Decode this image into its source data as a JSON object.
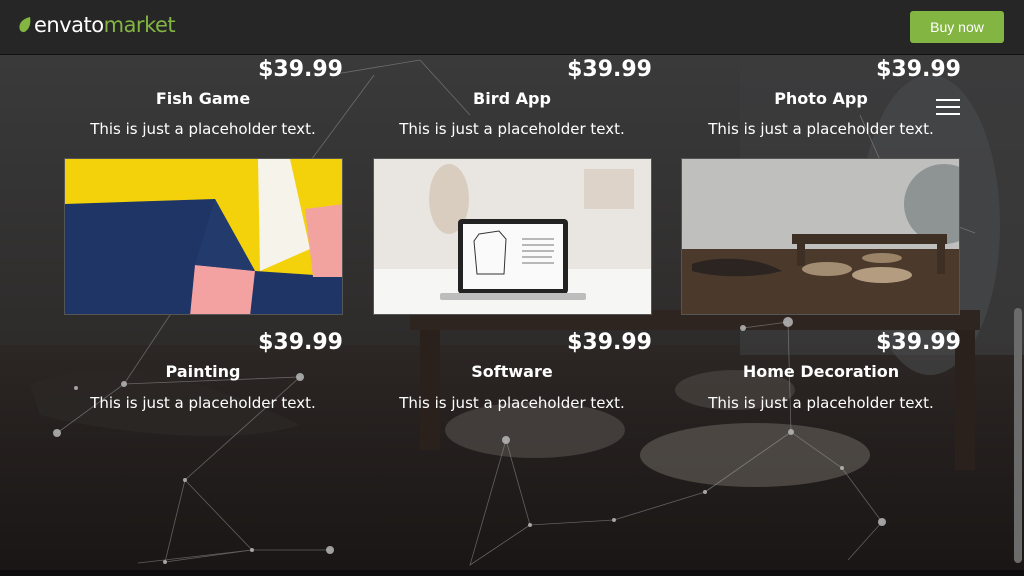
{
  "header": {
    "logo_part1": "envato",
    "logo_part2": "market",
    "buy_label": "Buy now"
  },
  "products": [
    {
      "price": "$39.99",
      "title": "Fish Game",
      "desc": "This is just a placeholder text."
    },
    {
      "price": "$39.99",
      "title": "Bird App",
      "desc": "This is just a placeholder text."
    },
    {
      "price": "$39.99",
      "title": "Photo App",
      "desc": "This is just a placeholder text."
    },
    {
      "price": "$39.99",
      "title": "Painting",
      "desc": "This is just a placeholder text."
    },
    {
      "price": "$39.99",
      "title": "Software",
      "desc": "This is just a placeholder text."
    },
    {
      "price": "$39.99",
      "title": "Home Decoration",
      "desc": "This is just a placeholder text."
    }
  ],
  "colors": {
    "accent": "#82b541",
    "topbar": "#262626"
  },
  "icons": [
    "leaf-icon",
    "hamburger-menu-icon"
  ]
}
